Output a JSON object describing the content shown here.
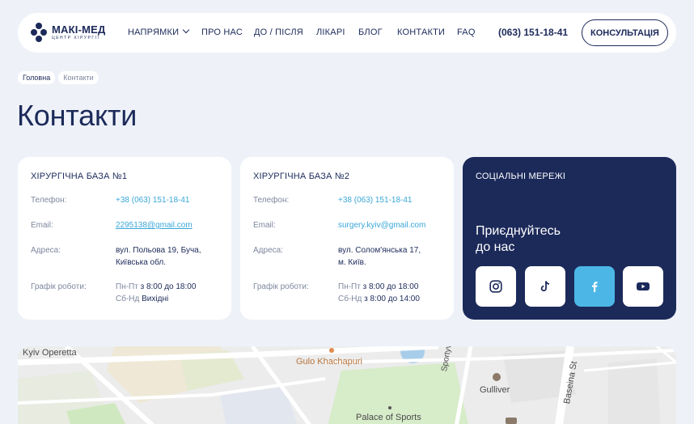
{
  "header": {
    "logo_name": "МАКІ-МЕД",
    "logo_sub": "ЦЕНТР ХІРУРГІЇ",
    "nav": [
      {
        "label": "НАПРЯМКИ"
      },
      {
        "label": "ПРО НАС"
      },
      {
        "label": "ДО / ПІСЛЯ"
      },
      {
        "label": "ЛІКАРІ"
      },
      {
        "label": "БЛОГ"
      },
      {
        "label": "КОНТАКТИ"
      },
      {
        "label": "FAQ"
      }
    ],
    "phone": "(063) 151-18-41",
    "consult_label": "КОНСУЛЬТАЦІЯ"
  },
  "breadcrumbs": [
    "Головна",
    "Контакти"
  ],
  "page_title": "Контакти",
  "bases": [
    {
      "title": "ХІРУРГІЧНА БАЗА №1",
      "phone_label": "Телефон:",
      "phone": "+38 (063) 151-18-41",
      "email_label": "Email:",
      "email": "2295138@gmail.com",
      "address_label": "Адреса:",
      "address_1": "вул. Польова 19, Буча,",
      "address_2": "Київська обл.",
      "hours_label": "Графік роботи:",
      "weekday_days": "Пн-Пт",
      "weekday_hours": "з 8:00 до 18:00",
      "weekend_days": "Сб-Нд",
      "weekend_hours": "Вихідні"
    },
    {
      "title": "ХІРУРГІЧНА БАЗА №2",
      "phone_label": "Телефон:",
      "phone": "+38 (063) 151-18-41",
      "email_label": "Email:",
      "email": "surgery.kyiv@gmail.com",
      "address_label": "Адреса:",
      "address_1": "вул. Солом'янська 17,",
      "address_2": "м. Київ.",
      "hours_label": "Графік роботи:",
      "weekday_days": "Пн-Пт",
      "weekday_hours": "з 8:00 до 18:00",
      "weekend_days": "Сб-Нд",
      "weekend_hours": "з 8:00 до 14:00"
    }
  ],
  "social": {
    "title": "СОЦІАЛЬНІ МЕРЕЖІ",
    "join_1": "Приєднуйтесь",
    "join_2": "до нас",
    "networks": [
      "instagram-icon",
      "tiktok-icon",
      "facebook-icon",
      "youtube-icon"
    ],
    "active_color": "#4cb7e6"
  },
  "map": {
    "labels": [
      "Kyiv Operetta",
      "Gulo Khachapuri",
      "Sportyvna Sq",
      "Gulliver",
      "Baseina St",
      "Palace of Sports"
    ]
  },
  "colors": {
    "brand": "#1c2a5a",
    "link": "#3aa7d9",
    "background": "#eef2f8"
  }
}
